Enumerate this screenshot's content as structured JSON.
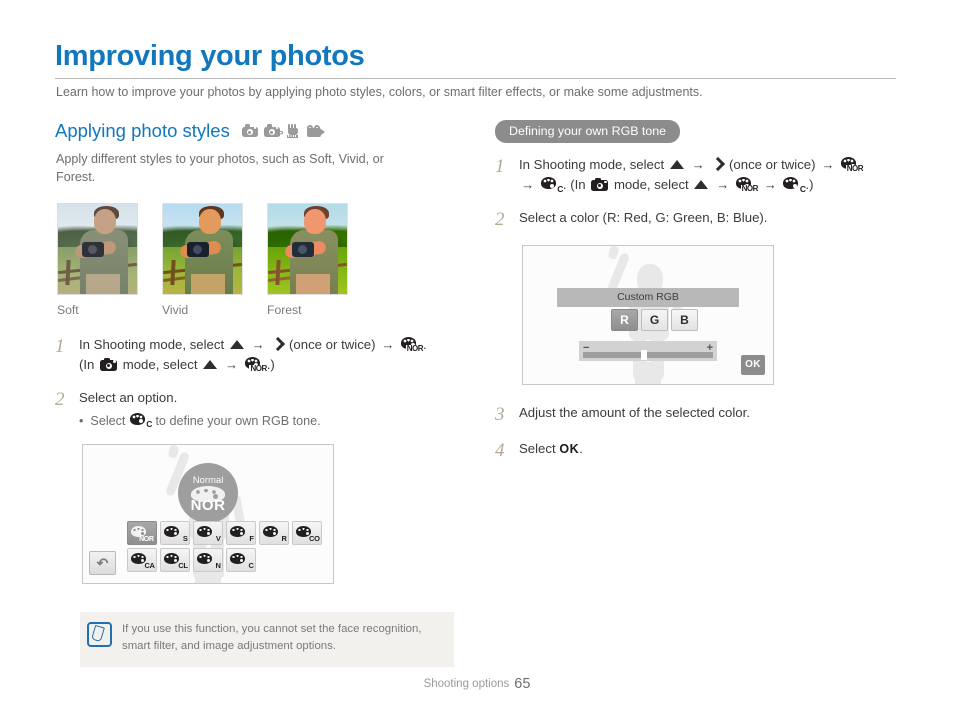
{
  "header": {
    "title": "Improving your photos",
    "subtitle": "Learn how to improve your photos by applying photo styles, colors, or smart filter effects, or make some adjustments.",
    "accent_color": "#1277bd"
  },
  "left_column": {
    "section_title": "Applying photo styles",
    "mode_icons": [
      "camera-icon",
      "program-camera-icon",
      "smart-burst-hand-icon",
      "video-camera-icon"
    ],
    "lead": "Apply different styles to your photos, such as Soft, Vivid, or Forest.",
    "samples": [
      {
        "caption": "Soft"
      },
      {
        "caption": "Vivid"
      },
      {
        "caption": "Forest"
      }
    ],
    "steps": [
      {
        "num": "1",
        "parts": [
          "In Shooting mode, select ",
          "up-arrow-icon",
          " → ",
          "right-arrow-icon",
          " (once or twice) → ",
          "palette-nor-icon",
          ". (In ",
          "camera-icon",
          " mode, select ",
          "up-arrow-icon",
          " → ",
          "palette-nor-icon",
          ".)"
        ],
        "text_a": "In Shooting mode, select",
        "text_b": "(once or twice)",
        "text_c": "(In",
        "text_d": "mode, select",
        "text_e": ".)"
      },
      {
        "num": "2",
        "title": "Select an option.",
        "bullet_pre": "Select",
        "bullet_post": "to define your own RGB tone."
      }
    ],
    "screen": {
      "bubble_label": "Normal",
      "bubble_code": "NOR",
      "tiles_row1": [
        "NOR",
        "S",
        "V",
        "F",
        "R",
        "CO"
      ],
      "tiles_row2": [
        "CA",
        "CL",
        "N",
        "C"
      ],
      "selected_tile": "NOR",
      "back_button": "back-arrow-icon"
    }
  },
  "right_column": {
    "badge": "Defining your own RGB tone",
    "steps": [
      {
        "num": "1",
        "text_a": "In Shooting mode, select",
        "text_b": "(once or twice)",
        "text_c": "(In",
        "text_d": "mode, select",
        "text_e": ".)"
      },
      {
        "num": "2",
        "title": "Select a color (R: Red, G: Green, B: Blue)."
      },
      {
        "num": "3",
        "title": "Adjust the amount of the selected color."
      },
      {
        "num": "4",
        "title_pre": "Select",
        "title_ok": "OK",
        "title_post": "."
      }
    ],
    "screen": {
      "title_bar": "Custom RGB",
      "color_buttons": [
        "R",
        "G",
        "B"
      ],
      "selected_color": "R",
      "slider_minus": "−",
      "slider_plus": "+",
      "ok_label": "OK"
    }
  },
  "note": {
    "icon": "note-pen-icon",
    "text": "If you use this function, you cannot set the face recognition, smart filter, and image adjustment options.",
    "accent_color": "#1f6fb2"
  },
  "footer": {
    "label": "Shooting options",
    "page": "65"
  }
}
